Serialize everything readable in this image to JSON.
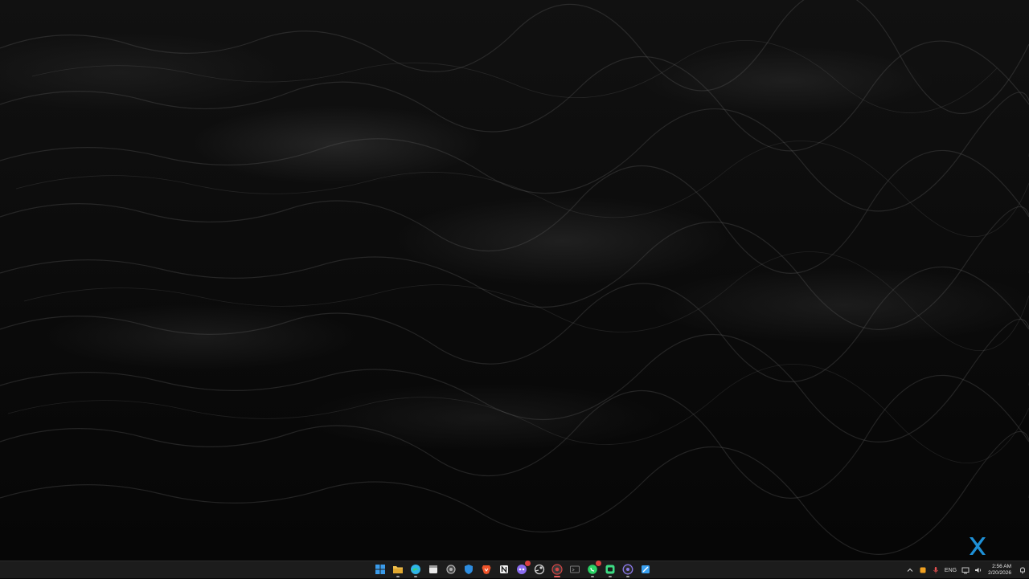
{
  "desktop": {
    "wallpaper": "dark-ocean-waves",
    "widget_icon": "x-icon",
    "widget_color": "#1e90d6"
  },
  "taskbar": {
    "background": "#1c1c1c",
    "apps": [
      {
        "name": "start",
        "icon": "windows-logo-icon",
        "color": "#3a9bea"
      },
      {
        "name": "file-explorer",
        "icon": "folder-icon",
        "color": "#f2c14e"
      },
      {
        "name": "edge",
        "icon": "edge-icon",
        "color": "#2fb5e8"
      },
      {
        "name": "calendar",
        "icon": "calendar-icon",
        "color": "#e8e8e8"
      },
      {
        "name": "settings",
        "icon": "gear-icon",
        "color": "#b0b0b0"
      },
      {
        "name": "defender",
        "icon": "shield-icon",
        "color": "#2d8de0"
      },
      {
        "name": "brave",
        "icon": "brave-lion-icon",
        "color": "#f0542a"
      },
      {
        "name": "notion",
        "icon": "notion-icon",
        "color": "#f0f0f0"
      },
      {
        "name": "copilot",
        "icon": "copilot-icon",
        "color": "#8a6cf0"
      },
      {
        "name": "steam",
        "icon": "steam-icon",
        "color": "#d0d0d0"
      },
      {
        "name": "chrome",
        "icon": "chrome-icon",
        "color": "#d64545"
      },
      {
        "name": "terminal",
        "icon": "terminal-icon",
        "color": "#7a7a7a"
      },
      {
        "name": "whatsapp",
        "icon": "whatsapp-icon",
        "color": "#2bd366"
      },
      {
        "name": "android-studio",
        "icon": "android-icon",
        "color": "#3ddc84"
      },
      {
        "name": "obs",
        "icon": "obs-icon",
        "color": "#8a78e8"
      },
      {
        "name": "snipping-tool",
        "icon": "snip-icon",
        "color": "#3aa0f0"
      }
    ]
  },
  "tray": {
    "chevron_icon": "chevron-up-icon",
    "language": "ENG",
    "time": "2:56 AM",
    "date": "2/20/2026"
  }
}
